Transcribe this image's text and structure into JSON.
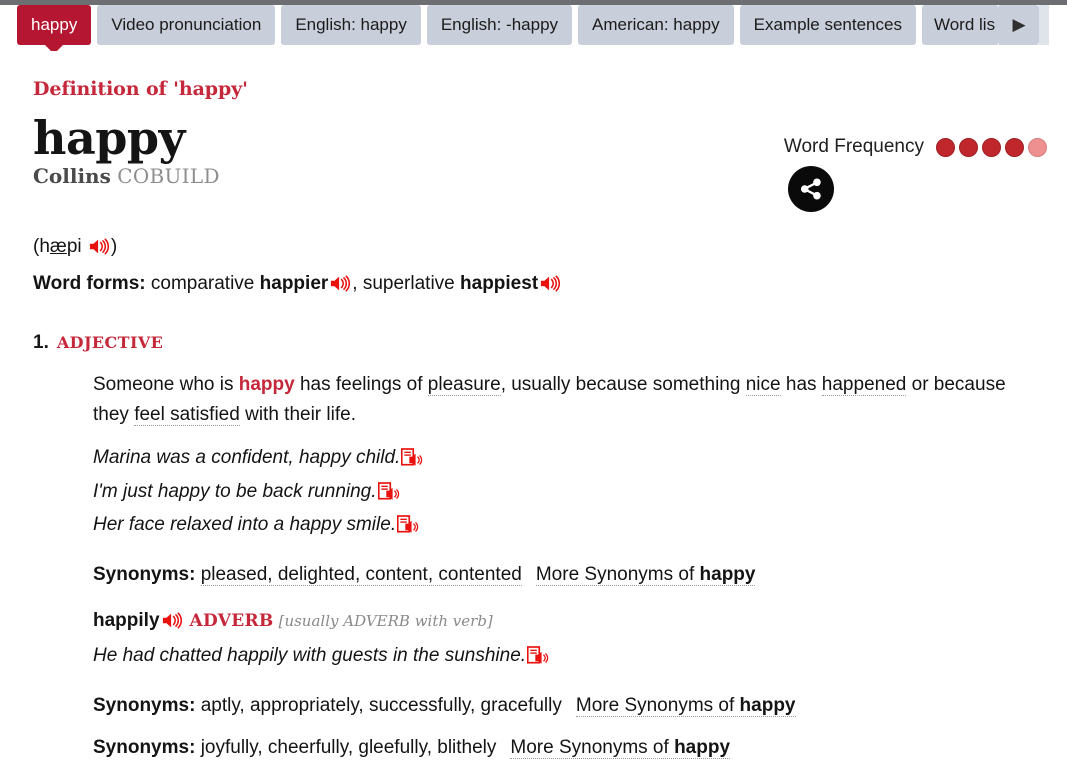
{
  "colors": {
    "brand_red": "#b51632",
    "heading_red": "#c5283b",
    "tab_inactive": "#c8cfdb",
    "freq_dot": "#c0272d",
    "freq_dot_faded": "#ef9090",
    "top_strip": "#6d6e71"
  },
  "tabs": [
    {
      "label": "happy",
      "active": true
    },
    {
      "label": "Video pronunciation",
      "active": false
    },
    {
      "label": "English: happy",
      "active": false
    },
    {
      "label": "English: -happy",
      "active": false
    },
    {
      "label": "American: happy",
      "active": false
    },
    {
      "label": "Example sentences",
      "active": false
    },
    {
      "label": "Word lis",
      "active": false
    }
  ],
  "tab_next_arrow": "▶",
  "header": {
    "definition_of": "Definition of 'happy'",
    "headword": "happy",
    "brand_bold": "Collins",
    "brand_light": "COBUILD"
  },
  "frequency": {
    "label": "Word Frequency",
    "filled": 4,
    "total": 5,
    "share_icon": "share-icon"
  },
  "pronunciation": {
    "open_paren": "(h",
    "stressed": "æ",
    "rest": "pi",
    "close_paren": ")"
  },
  "word_forms": {
    "label": "Word forms:",
    "comparative_label": "comparative",
    "comparative": "happier",
    "separator": ",",
    "superlative_label": "superlative",
    "superlative": "happiest"
  },
  "sense": {
    "number": "1.",
    "part_of_speech": "ADJECTIVE",
    "definition": {
      "p1": "Someone who is ",
      "highlight": "happy",
      "p2": " has feelings of ",
      "d1": "pleasure",
      "p3": ", usually because something ",
      "d2": "nice",
      "p4": " has ",
      "d3": "happened",
      "p5": " or because they ",
      "d4": "feel satisfied",
      "p6": " with their life."
    },
    "examples": [
      "Marina was a confident, happy child.",
      "I'm just happy to be back running.",
      "Her face relaxed into a happy smile."
    ],
    "synonyms": {
      "label": "Synonyms:",
      "words": "pleased, delighted, content, contented",
      "more_prefix": "More Synonyms of ",
      "more_word": "happy"
    },
    "run_on": {
      "word": "happily",
      "part_of_speech": "ADVERB",
      "grammar_note": "[usually ADVERB with verb]",
      "example": "He had chatted happily with guests in the sunshine."
    },
    "synonyms2": {
      "label": "Synonyms:",
      "words": "aptly, appropriately, successfully, gracefully",
      "more_prefix": "More Synonyms of ",
      "more_word": "happy"
    },
    "synonyms3": {
      "label": "Synonyms:",
      "words": "joyfully, cheerfully, gleefully, blithely",
      "more_prefix": "More Synonyms of ",
      "more_word": "happy"
    }
  }
}
